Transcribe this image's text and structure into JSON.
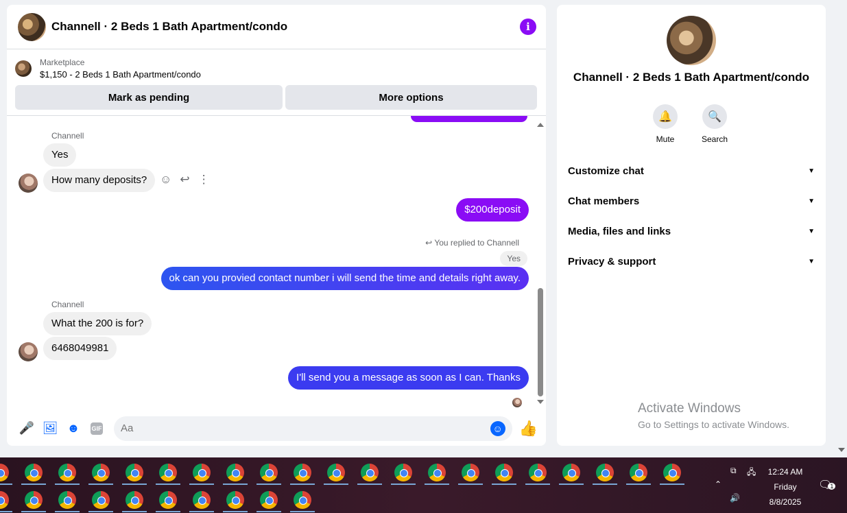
{
  "chat": {
    "title": "Channell · 2 Beds 1 Bath Apartment/condo",
    "info_icon": "info-icon",
    "marketplace": {
      "label": "Marketplace",
      "listing": "$1,150 - 2 Beds 1 Bath Apartment/condo",
      "mark_pending": "Mark as pending",
      "more_options": "More options"
    },
    "messages": {
      "sender1": "Channell",
      "m1": "Yes",
      "m2": "How many deposits?",
      "m3": "$200deposit",
      "reply_note": "You replied to Channell",
      "quoted": "Yes",
      "m4": "ok can you provied contact number i will send the time and details right away.",
      "sender2": "Channell",
      "m5": "What the 200 is for?",
      "m6": "6468049981",
      "m7": "I'll send you a message as soon as I can. Thanks"
    },
    "composer": {
      "placeholder": "Aa",
      "gif": "GIF"
    }
  },
  "info_panel": {
    "title": "Channell · 2 Beds 1 Bath Apartment/condo",
    "mute": "Mute",
    "search": "Search",
    "sections": [
      "Customize chat",
      "Chat members",
      "Media, files and links",
      "Privacy & support"
    ]
  },
  "watermark": {
    "line1": "Activate Windows",
    "line2": "Go to Settings to activate Windows."
  },
  "taskbar": {
    "time": "12:24 AM",
    "day": "Friday",
    "date": "8/8/2025",
    "notifications": "1"
  },
  "colors": {
    "accent_purple": "#8a0cf5",
    "accent_blue": "#3b3bf0",
    "messenger_blue": "#0866ff"
  }
}
